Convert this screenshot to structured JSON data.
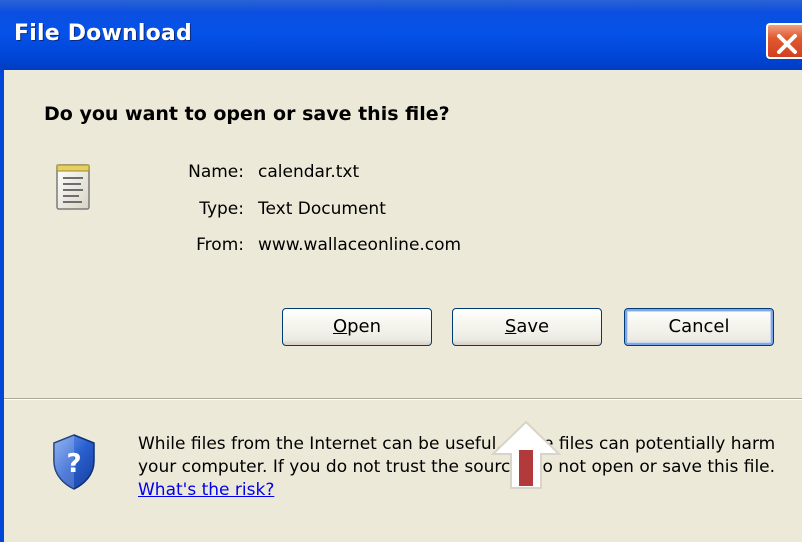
{
  "window": {
    "title": "File Download",
    "close_icon": "close-icon",
    "colors": {
      "title_bar": "#0052e5",
      "body": "#ece9d8",
      "close_button": "#e05a30",
      "link": "#0000ee",
      "annotation_arrow": "#b23a3a"
    }
  },
  "dialog": {
    "question": "Do you want to open or save this file?",
    "file_icon": "text-file-icon",
    "fields": {
      "name_label": "Name:",
      "name_value": "calendar.txt",
      "type_label": "Type:",
      "type_value": "Text Document",
      "from_label": "From:",
      "from_value": "www.wallaceonline.com"
    },
    "buttons": {
      "open": "Open",
      "save": "Save",
      "cancel": "Cancel"
    },
    "warning": {
      "icon": "shield-question-icon",
      "text": "While files from the Internet can be useful, some files can potentially harm your computer. If you do not trust the source, do not open or save this file. ",
      "link": "What's the risk?"
    },
    "annotation": {
      "icon": "up-arrow-icon"
    }
  }
}
